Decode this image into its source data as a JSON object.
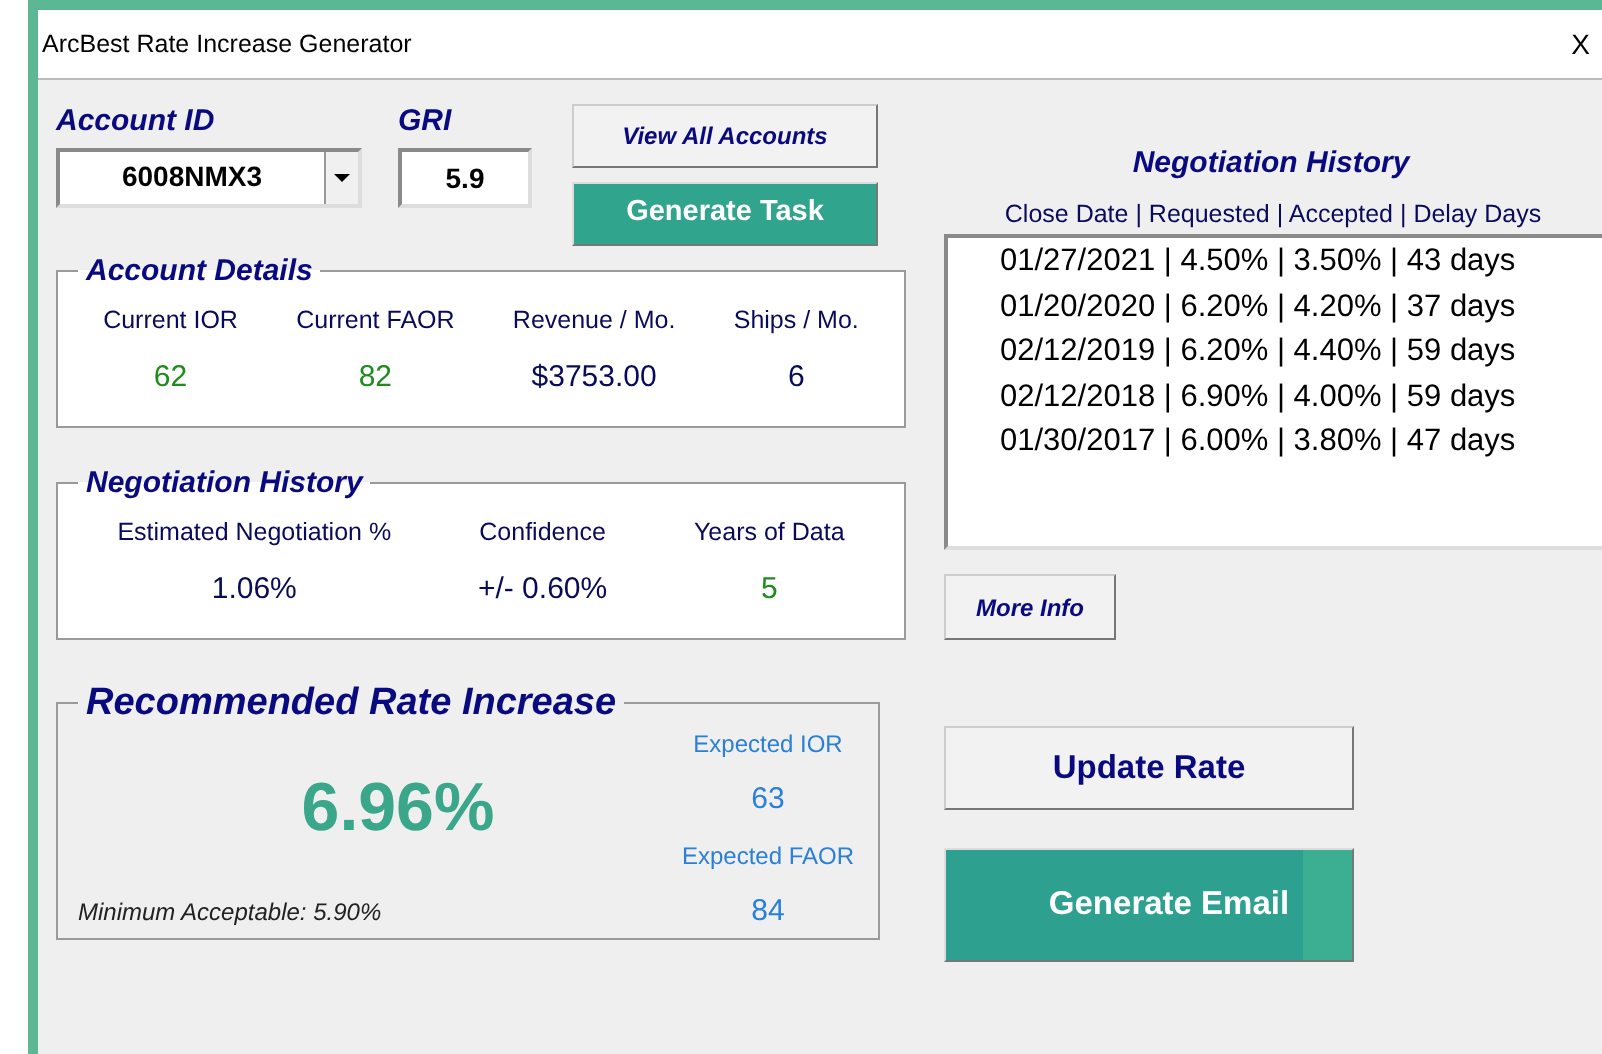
{
  "window": {
    "title": "ArcBest Rate Increase Generator",
    "close": "X"
  },
  "account": {
    "label": "Account ID",
    "value": "6008NMX3"
  },
  "gri": {
    "label": "GRI",
    "value": "5.9"
  },
  "buttons_top": [
    "View All Accounts",
    "Generate Task"
  ],
  "account_details": {
    "title": "Account Details",
    "stats": [
      {
        "label": "Current IOR",
        "value": "62",
        "color": "#1e8c1e"
      },
      {
        "label": "Current FAOR",
        "value": "82",
        "color": "#1e8c1e"
      },
      {
        "label": "Revenue / Mo.",
        "value": "$3753.00",
        "color": "#0a0a5a"
      },
      {
        "label": "Ships / Mo.",
        "value": "6",
        "color": "#0a0a5a"
      }
    ]
  },
  "negotiation_summary": {
    "title": "Negotiation History",
    "stats": [
      {
        "label": "Estimated Negotiation %",
        "value": "1.06%",
        "color": "#0a0a5a"
      },
      {
        "label": "Confidence",
        "value": "+/- 0.60%",
        "color": "#0a0a5a"
      },
      {
        "label": "Years of Data",
        "value": "5",
        "color": "#1e8c1e"
      }
    ]
  },
  "recommended": {
    "title": "Recommended Rate Increase",
    "value": "6.96%",
    "minimum": "Minimum Acceptable: 5.90%",
    "expected": [
      {
        "label": "Expected IOR",
        "value": "63"
      },
      {
        "label": "Expected FAOR",
        "value": "84"
      }
    ]
  },
  "history": {
    "title": "Negotiation History",
    "columns": "Close Date | Requested | Accepted | Delay Days",
    "rows": [
      "01/27/2021 | 4.50% | 3.50% | 43 days",
      "01/20/2020 | 6.20% | 4.20% | 37 days",
      "02/12/2019 | 6.20% | 4.40% | 59 days",
      "02/12/2018 | 6.90% | 4.00% | 59 days",
      "01/30/2017 | 6.00% | 3.80% | 47 days"
    ],
    "more": "More Info"
  },
  "buttons_bottom": [
    "Update Rate",
    "Generate Email"
  ]
}
